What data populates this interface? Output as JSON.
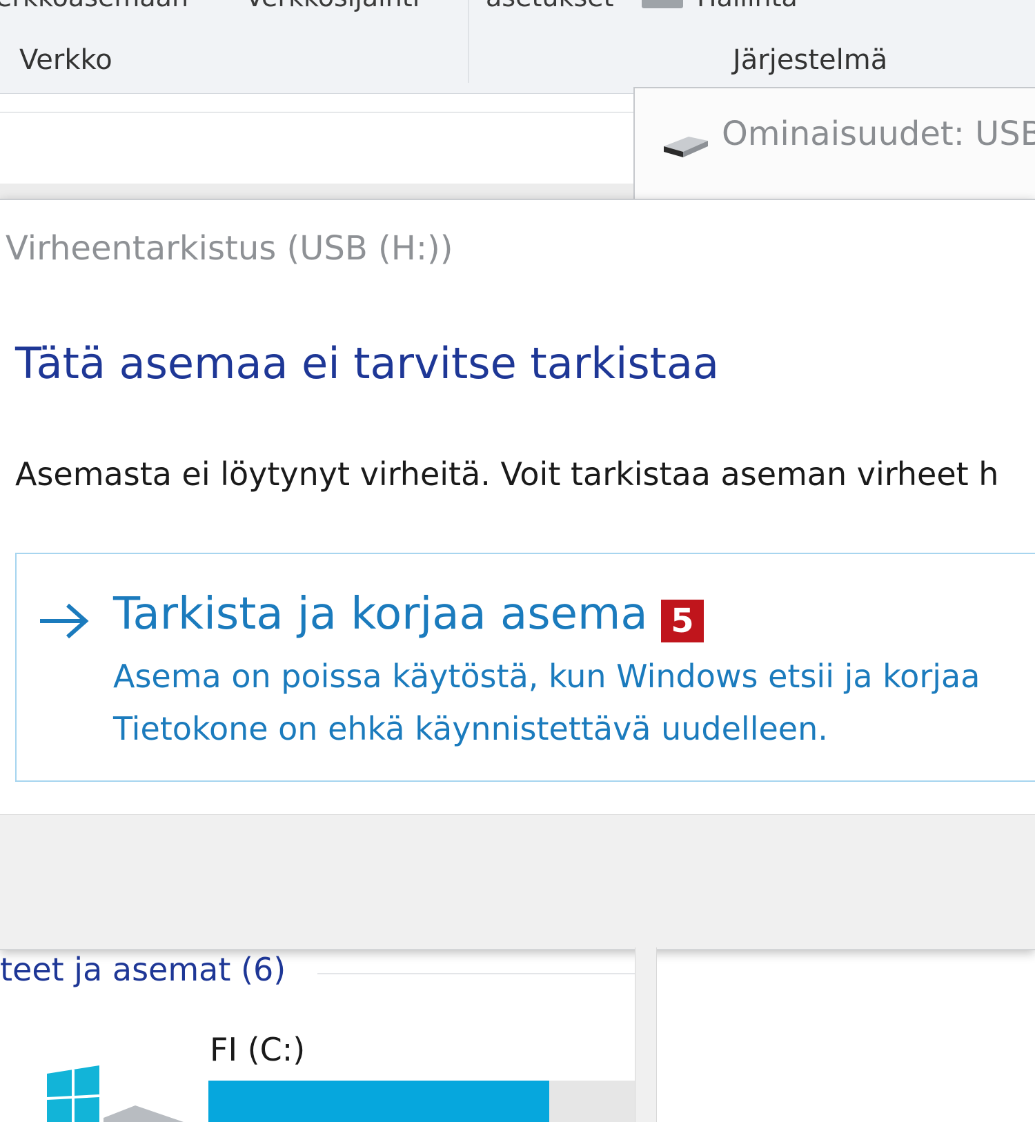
{
  "ribbon": {
    "top_items": [
      "erkkoasemaan",
      "Verkkosijainti",
      "asetukset",
      "Hallinta"
    ],
    "groups": [
      "Verkko",
      "Järjestelmä"
    ]
  },
  "properties_window": {
    "title": "Ominaisuudet: USB"
  },
  "dialog": {
    "title": "Virheentarkistus (USB (H:))",
    "heading": "Tätä asemaa ei tarvitse tarkistaa",
    "body": "Asemasta ei löytynyt virheitä. Voit tarkistaa aseman virheet h",
    "action": {
      "title": "Tarkista ja korjaa asema",
      "badge": "5",
      "description_line1": "Asema on poissa käytöstä, kun Windows etsii ja korjaa",
      "description_line2": "Tietokone on ehkä käynnistettävä uudelleen."
    }
  },
  "content": {
    "group_header": "teet ja asemat (6)",
    "drive": {
      "name": "FI (C:)",
      "used_fraction": 0.8
    }
  },
  "colors": {
    "heading": "#1e3796",
    "action": "#1b7bbd",
    "badge": "#c0151c",
    "drive_bar": "#06a7dd"
  }
}
